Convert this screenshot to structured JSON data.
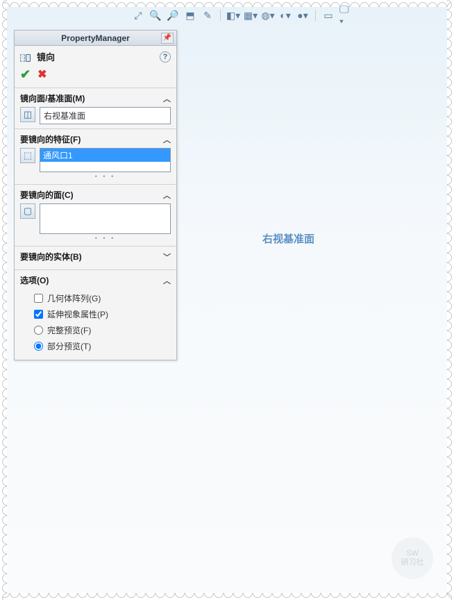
{
  "panel": {
    "title": "PropertyManager",
    "feature_name": "镜向",
    "sections": {
      "mirror_plane": {
        "label": "镜向面/基准面(M)",
        "value": "右视基准面"
      },
      "features": {
        "label": "要镜向的特征(F)",
        "selected": "通风口1"
      },
      "faces": {
        "label": "要镜向的面(C)"
      },
      "bodies": {
        "label": "要镜向的实体(B)"
      },
      "options": {
        "label": "选项(O)",
        "geom_pattern": "几何体阵列(G)",
        "propagate": "延伸视象属性(P)",
        "full_preview": "完整预览(F)",
        "partial_preview": "部分预览(T)"
      }
    }
  },
  "viewport": {
    "plane_label": "右视基准面"
  },
  "watermark": {
    "line1": "SW",
    "line2": "研习社"
  }
}
